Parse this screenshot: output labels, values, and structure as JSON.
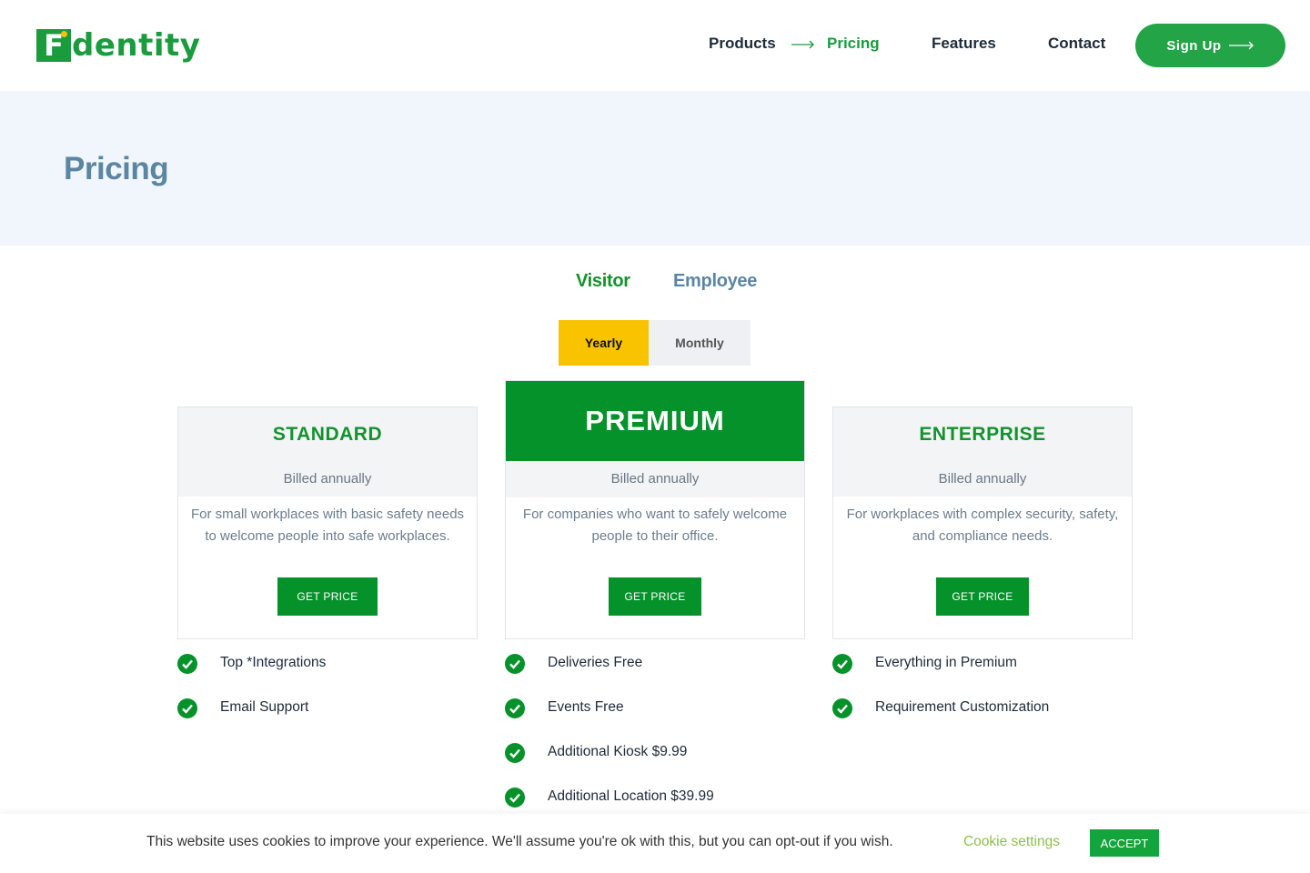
{
  "brand": {
    "logo_letter": "F",
    "logo_rest": "dentity",
    "green": "#1a9c3e",
    "yellow": "#f9c300"
  },
  "nav": {
    "products": "Products",
    "pricing": "Pricing",
    "features": "Features",
    "contact": "Contact",
    "signup": "Sign Up"
  },
  "hero": {
    "title": "Pricing"
  },
  "tabs": {
    "visitor": "Visitor",
    "employee": "Employee"
  },
  "billing_toggle": {
    "yearly": "Yearly",
    "monthly": "Monthly",
    "active": "Yearly"
  },
  "plans": [
    {
      "name": "STANDARD",
      "billed": "Billed annually",
      "desc_line1": "For small workplaces with basic safety needs",
      "desc_line2": "to welcome people into safe workplaces.",
      "cta": "GET PRICE",
      "features": [
        "Top *Integrations",
        "Email Support"
      ]
    },
    {
      "name": "PREMIUM",
      "billed": "Billed annually",
      "desc_line1": "For companies who want to safely welcome",
      "desc_line2": "people to their office.",
      "cta": "GET PRICE",
      "features": [
        "Deliveries Free",
        "Events Free",
        "Additional Kiosk $9.99",
        "Additional Location $39.99"
      ]
    },
    {
      "name": "ENTERPRISE",
      "billed": "Billed annually",
      "desc_line1": "For workplaces with complex security, safety,",
      "desc_line2": "and compliance needs.",
      "cta": "GET PRICE",
      "features": [
        "Everything in Premium",
        "Requirement Customization"
      ]
    }
  ],
  "cookie": {
    "text": "This website uses cookies to improve your experience. We'll assume you're ok with this, but you can opt-out if you wish.",
    "settings": "Cookie settings",
    "accept": "ACCEPT"
  }
}
